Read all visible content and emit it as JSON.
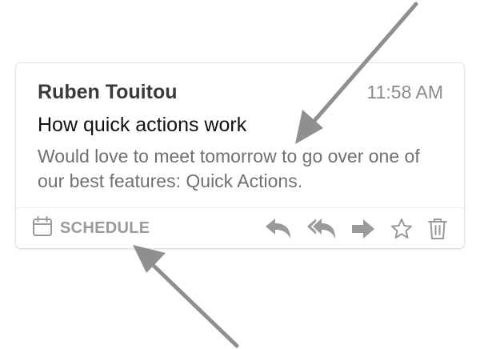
{
  "email": {
    "sender": "Ruben Touitou",
    "time": "11:58 AM",
    "subject": "How quick actions work",
    "snippet": "Would love to meet tomorrow to go over one of our best features: Quick Actions."
  },
  "footer": {
    "schedule_label": "SCHEDULE",
    "schedule_icon": "calendar-icon",
    "actions": [
      "reply-icon",
      "reply-all-icon",
      "forward-icon",
      "star-icon",
      "trash-icon"
    ]
  },
  "colors": {
    "icon_gray": "#9a9a9a",
    "arrow_gray": "#8f8f8f",
    "sender_text": "#3a3a3a",
    "snippet_text": "#707070"
  }
}
